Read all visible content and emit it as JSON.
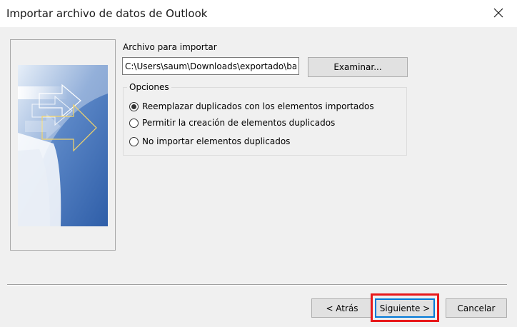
{
  "window": {
    "title": "Importar archivo de datos de Outlook",
    "close_icon": "close-icon"
  },
  "file": {
    "label": "Archivo para importar",
    "path_value": "C:\\Users\\saum\\Downloads\\exportado\\ba",
    "browse_label": "Examinar..."
  },
  "options": {
    "legend": "Opciones",
    "items": [
      {
        "label": "Reemplazar duplicados con los elementos importados",
        "selected": true
      },
      {
        "label": "Permitir la creación de elementos duplicados",
        "selected": false
      },
      {
        "label": "No importar elementos duplicados",
        "selected": false
      }
    ]
  },
  "footer": {
    "back_label": "< Atrás",
    "next_label": "Siguiente >",
    "cancel_label": "Cancelar"
  },
  "colors": {
    "highlight": "#e8191b",
    "focus_border": "#0078d7"
  }
}
